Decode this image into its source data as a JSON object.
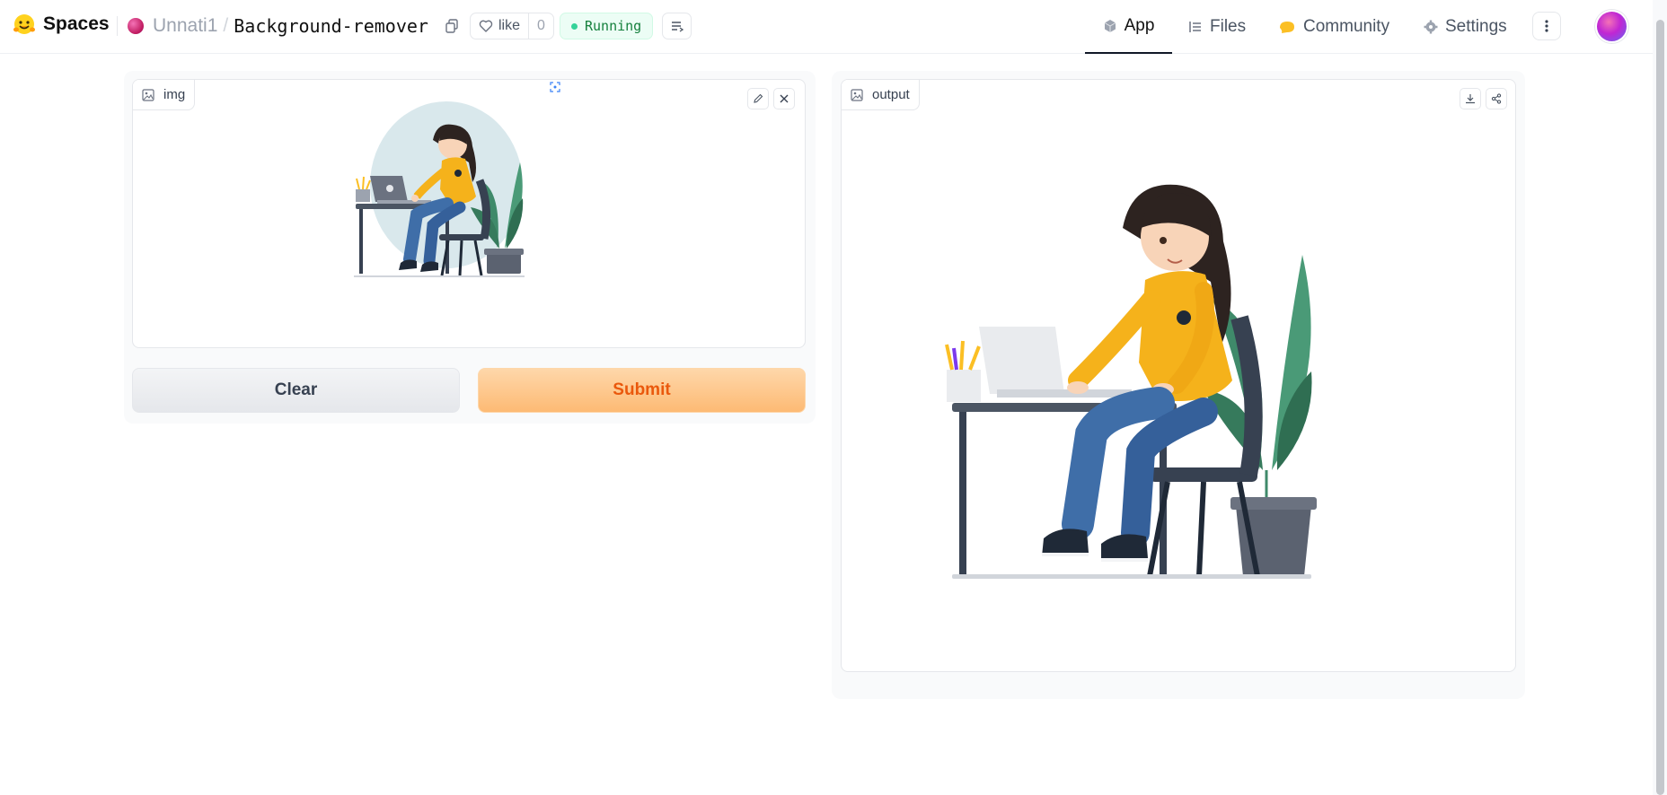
{
  "header": {
    "brand": "Spaces",
    "owner": "Unnati1",
    "separator": "/",
    "repo": "Background-remover",
    "like_label": "like",
    "like_count": "0",
    "status": "Running",
    "nav": {
      "app": "App",
      "files": "Files",
      "community": "Community",
      "settings": "Settings"
    }
  },
  "input": {
    "label": "img",
    "clear_label": "Clear",
    "submit_label": "Submit"
  },
  "output": {
    "label": "output"
  },
  "colors": {
    "accent": "#ea580c",
    "submit_bg": "#fdba74",
    "running": "#15803d",
    "shirt": "#f5b21b",
    "jeans": "#3f6ea8",
    "plant": "#3f8a6a"
  }
}
